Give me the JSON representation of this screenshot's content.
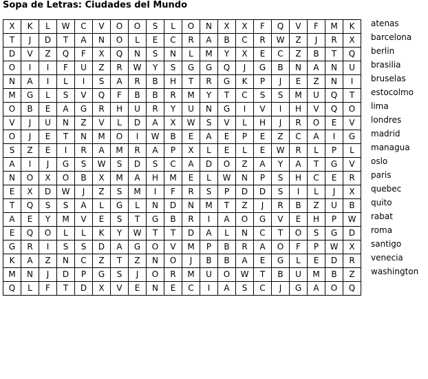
{
  "title": "Sopa de Letras: Ciudades del Mundo",
  "grid": [
    [
      "X",
      "K",
      "L",
      "W",
      "C",
      "V",
      "O",
      "O",
      "S",
      "L",
      "O",
      "N",
      "X",
      "X",
      "F",
      "Q",
      "V",
      "F",
      "M",
      "K"
    ],
    [
      "T",
      "J",
      "D",
      "T",
      "A",
      "N",
      "O",
      "L",
      "E",
      "C",
      "R",
      "A",
      "B",
      "C",
      "R",
      "W",
      "Z",
      "J",
      "R",
      "X"
    ],
    [
      "D",
      "V",
      "Z",
      "Q",
      "F",
      "X",
      "Q",
      "N",
      "S",
      "N",
      "L",
      "M",
      "Y",
      "X",
      "E",
      "C",
      "Z",
      "B",
      "T",
      "Q"
    ],
    [
      "O",
      "I",
      "I",
      "F",
      "U",
      "Z",
      "R",
      "W",
      "Y",
      "S",
      "G",
      "G",
      "Q",
      "J",
      "G",
      "B",
      "N",
      "A",
      "N",
      "U"
    ],
    [
      "N",
      "A",
      "I",
      "L",
      "I",
      "S",
      "A",
      "R",
      "B",
      "H",
      "T",
      "R",
      "G",
      "K",
      "P",
      "J",
      "E",
      "Z",
      "N",
      "I"
    ],
    [
      "M",
      "G",
      "L",
      "S",
      "V",
      "Q",
      "F",
      "B",
      "B",
      "R",
      "M",
      "Y",
      "T",
      "C",
      "S",
      "S",
      "M",
      "U",
      "Q",
      "T"
    ],
    [
      "O",
      "B",
      "E",
      "A",
      "G",
      "R",
      "H",
      "U",
      "R",
      "Y",
      "U",
      "N",
      "G",
      "I",
      "V",
      "I",
      "H",
      "V",
      "Q",
      "O"
    ],
    [
      "V",
      "J",
      "U",
      "N",
      "Z",
      "V",
      "L",
      "D",
      "A",
      "X",
      "W",
      "S",
      "V",
      "L",
      "H",
      "J",
      "R",
      "O",
      "E",
      "V"
    ],
    [
      "O",
      "J",
      "E",
      "T",
      "N",
      "M",
      "O",
      "I",
      "W",
      "B",
      "E",
      "A",
      "E",
      "P",
      "E",
      "Z",
      "C",
      "A",
      "I",
      "G"
    ],
    [
      "S",
      "Z",
      "E",
      "I",
      "R",
      "A",
      "M",
      "R",
      "A",
      "P",
      "X",
      "L",
      "E",
      "L",
      "E",
      "W",
      "R",
      "L",
      "P",
      "L"
    ],
    [
      "A",
      "I",
      "J",
      "G",
      "S",
      "W",
      "S",
      "D",
      "S",
      "C",
      "A",
      "D",
      "O",
      "Z",
      "A",
      "Y",
      "A",
      "T",
      "G",
      "V"
    ],
    [
      "N",
      "O",
      "X",
      "O",
      "B",
      "X",
      "M",
      "A",
      "H",
      "M",
      "E",
      "L",
      "W",
      "N",
      "P",
      "S",
      "H",
      "C",
      "E",
      "R"
    ],
    [
      "E",
      "X",
      "D",
      "W",
      "J",
      "Z",
      "S",
      "M",
      "I",
      "F",
      "R",
      "S",
      "P",
      "D",
      "D",
      "S",
      "I",
      "L",
      "J",
      "X"
    ],
    [
      "T",
      "Q",
      "S",
      "S",
      "A",
      "L",
      "G",
      "L",
      "N",
      "D",
      "N",
      "M",
      "T",
      "Z",
      "J",
      "R",
      "B",
      "Z",
      "U",
      "B"
    ],
    [
      "A",
      "E",
      "Y",
      "M",
      "V",
      "E",
      "S",
      "T",
      "G",
      "B",
      "R",
      "I",
      "A",
      "O",
      "G",
      "V",
      "E",
      "H",
      "P",
      "W"
    ],
    [
      "E",
      "Q",
      "O",
      "L",
      "L",
      "K",
      "Y",
      "W",
      "T",
      "T",
      "D",
      "A",
      "L",
      "N",
      "C",
      "T",
      "O",
      "S",
      "G",
      "D"
    ],
    [
      "G",
      "R",
      "I",
      "S",
      "S",
      "D",
      "A",
      "G",
      "O",
      "V",
      "M",
      "P",
      "B",
      "R",
      "A",
      "O",
      "F",
      "P",
      "W",
      "X"
    ],
    [
      "K",
      "A",
      "Z",
      "N",
      "C",
      "Z",
      "T",
      "Z",
      "N",
      "O",
      "J",
      "B",
      "B",
      "A",
      "E",
      "G",
      "L",
      "E",
      "D",
      "R"
    ],
    [
      "M",
      "N",
      "J",
      "D",
      "P",
      "G",
      "S",
      "J",
      "O",
      "R",
      "M",
      "U",
      "O",
      "W",
      "T",
      "B",
      "U",
      "M",
      "B",
      "Z"
    ],
    [
      "Q",
      "L",
      "F",
      "T",
      "D",
      "X",
      "V",
      "E",
      "N",
      "E",
      "C",
      "I",
      "A",
      "S",
      "C",
      "J",
      "G",
      "A",
      "O",
      "Q"
    ]
  ],
  "words": [
    "atenas",
    "barcelona",
    "berlin",
    "brasilia",
    "bruselas",
    "estocolmo",
    "lima",
    "londres",
    "madrid",
    "managua",
    "oslo",
    "paris",
    "quebec",
    "quito",
    "rabat",
    "roma",
    "santigo",
    "venecia",
    "washington"
  ]
}
